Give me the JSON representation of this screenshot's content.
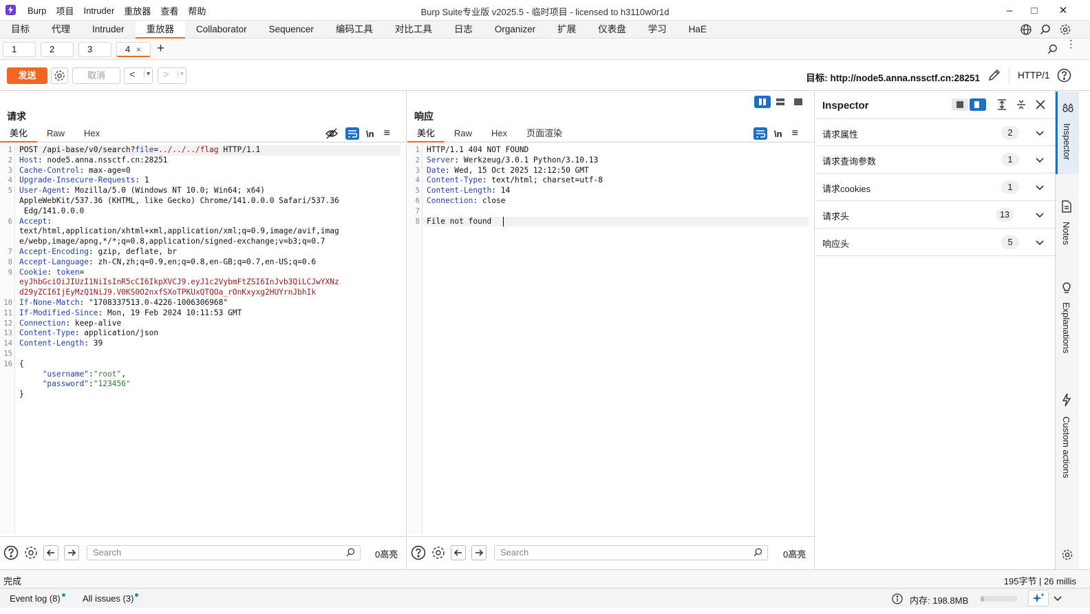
{
  "window": {
    "title": "Burp Suite专业版  v2025.5 - 临时项目 - licensed to h3110w0r1d",
    "menu": [
      "Burp",
      "项目",
      "Intruder",
      "重放器",
      "查看",
      "帮助"
    ],
    "minimize": "–",
    "maximize": "□",
    "close": "✕"
  },
  "nav": {
    "tabs": [
      "目标",
      "代理",
      "Intruder",
      "重放器",
      "Collaborator",
      "Sequencer",
      "编码工具",
      "对比工具",
      "日志",
      "Organizer",
      "扩展",
      "仪表盘",
      "学习",
      "HaE"
    ],
    "active": 3
  },
  "subtabs": {
    "items": [
      "1",
      "2",
      "3",
      "4"
    ],
    "active_close": "×",
    "add": "+"
  },
  "toolbar": {
    "send": "发送",
    "cancel": "取消",
    "back": "<",
    "back_dropdown": "▾",
    "forward": ">",
    "forward_dropdown": "▾",
    "target": "目标: http://node5.anna.nssctf.cn:28251",
    "http_version": "HTTP/1"
  },
  "request": {
    "title": "请求",
    "tabs": [
      "美化",
      "Raw",
      "Hex"
    ],
    "newline_toggle": "\\n",
    "lines": [
      {
        "n": "1",
        "parts": [
          [
            "",
            "POST /api-base/v0/search?"
          ],
          [
            "hn",
            "file"
          ],
          [
            "",
            "="
          ],
          [
            "pv",
            "../../../flag"
          ],
          [
            "",
            " HTTP/1.1"
          ]
        ]
      },
      {
        "n": "2",
        "parts": [
          [
            "hn",
            "Host"
          ],
          [
            "",
            ": node5.anna.nssctf.cn:28251"
          ]
        ]
      },
      {
        "n": "3",
        "parts": [
          [
            "hn",
            "Cache-Control"
          ],
          [
            "",
            ": max-age=0"
          ]
        ]
      },
      {
        "n": "4",
        "parts": [
          [
            "hn",
            "Upgrade-Insecure-Requests"
          ],
          [
            "",
            ": 1"
          ]
        ]
      },
      {
        "n": "5",
        "parts": [
          [
            "hn",
            "User-Agent"
          ],
          [
            "",
            ": Mozilla/5.0 (Windows NT 10.0; Win64; x64)"
          ]
        ]
      },
      {
        "n": "",
        "parts": [
          [
            "",
            "AppleWebKit/537.36 (KHTML, like Gecko) Chrome/141.0.0.0 Safari/537.36"
          ]
        ]
      },
      {
        "n": "",
        "parts": [
          [
            "",
            " Edg/141.0.0.0"
          ]
        ]
      },
      {
        "n": "6",
        "parts": [
          [
            "hn",
            "Accept"
          ],
          [
            "",
            ":"
          ]
        ]
      },
      {
        "n": "",
        "parts": [
          [
            "",
            "text/html,application/xhtml+xml,application/xml;q=0.9,image/avif,imag"
          ]
        ]
      },
      {
        "n": "",
        "parts": [
          [
            "",
            "e/webp,image/apng,*/*;q=0.8,application/signed-exchange;v=b3;q=0.7"
          ]
        ]
      },
      {
        "n": "7",
        "parts": [
          [
            "hn",
            "Accept-Encoding"
          ],
          [
            "",
            ": gzip, deflate, br"
          ]
        ]
      },
      {
        "n": "8",
        "parts": [
          [
            "hn",
            "Accept-Language"
          ],
          [
            "",
            ": zh-CN,zh;q=0.9,en;q=0.8,en-GB;q=0.7,en-US;q=0.6"
          ]
        ]
      },
      {
        "n": "9",
        "parts": [
          [
            "hn",
            "Cookie"
          ],
          [
            "",
            ": "
          ],
          [
            "hn",
            "token"
          ],
          [
            "",
            "="
          ]
        ]
      },
      {
        "n": "",
        "parts": [
          [
            "pv",
            "eyJhbGciOiJIUzI1NiIsInR5cCI6IkpXVCJ9.eyJ1c2VybmFtZSI6InJvb3QiLCJwYXNz"
          ]
        ]
      },
      {
        "n": "",
        "parts": [
          [
            "pv",
            "d29yZCI6IjEyMzQ1NiJ9.V0KS0O2nxfSXoTPKUxQTQOa_rOnKxyxg2HUYrnJbhIk"
          ]
        ]
      },
      {
        "n": "10",
        "parts": [
          [
            "hn",
            "If-None-Match"
          ],
          [
            "",
            ": \"1708337513.0-4226-1006306968\""
          ]
        ]
      },
      {
        "n": "11",
        "parts": [
          [
            "hn",
            "If-Modified-Since"
          ],
          [
            "",
            ": Mon, 19 Feb 2024 10:11:53 GMT"
          ]
        ]
      },
      {
        "n": "12",
        "parts": [
          [
            "hn",
            "Connection"
          ],
          [
            "",
            ": keep-alive"
          ]
        ]
      },
      {
        "n": "13",
        "parts": [
          [
            "hn",
            "Content-Type"
          ],
          [
            "",
            ": application/json"
          ]
        ]
      },
      {
        "n": "14",
        "parts": [
          [
            "hn",
            "Content-Length"
          ],
          [
            "",
            ": 39"
          ]
        ]
      },
      {
        "n": "15",
        "parts": [
          [
            "",
            ""
          ]
        ]
      },
      {
        "n": "16",
        "parts": [
          [
            "",
            "{"
          ]
        ]
      },
      {
        "n": "",
        "parts": [
          [
            "",
            "     "
          ],
          [
            "jk",
            "\"username\""
          ],
          [
            "",
            ":"
          ],
          [
            "jv",
            "\"root\""
          ],
          [
            "",
            ","
          ]
        ]
      },
      {
        "n": "",
        "parts": [
          [
            "",
            "     "
          ],
          [
            "jk",
            "\"password\""
          ],
          [
            "",
            ":"
          ],
          [
            "jv",
            "\"123456\""
          ]
        ]
      },
      {
        "n": "",
        "parts": [
          [
            "",
            "}"
          ]
        ]
      }
    ],
    "search_placeholder": "Search",
    "highlights": "0高亮"
  },
  "response": {
    "title": "响应",
    "tabs": [
      "美化",
      "Raw",
      "Hex",
      "页面渲染"
    ],
    "newline_toggle": "\\n",
    "lines": [
      {
        "n": "1",
        "parts": [
          [
            "",
            "HTTP/1.1 404 NOT FOUND"
          ]
        ]
      },
      {
        "n": "2",
        "parts": [
          [
            "hn",
            "Server"
          ],
          [
            "",
            ": Werkzeug/3.0.1 Python/3.10.13"
          ]
        ]
      },
      {
        "n": "3",
        "parts": [
          [
            "hn",
            "Date"
          ],
          [
            "",
            ": Wed, 15 Oct 2025 12:12:50 GMT"
          ]
        ]
      },
      {
        "n": "4",
        "parts": [
          [
            "hn",
            "Content-Type"
          ],
          [
            "",
            ": text/html; charset=utf-8"
          ]
        ]
      },
      {
        "n": "5",
        "parts": [
          [
            "hn",
            "Content-Length"
          ],
          [
            "",
            ": 14"
          ]
        ]
      },
      {
        "n": "6",
        "parts": [
          [
            "hn",
            "Connection"
          ],
          [
            "",
            ": close"
          ]
        ]
      },
      {
        "n": "7",
        "parts": [
          [
            "",
            ""
          ]
        ]
      },
      {
        "n": "8",
        "parts": [
          [
            "",
            "File not found"
          ]
        ]
      }
    ],
    "search_placeholder": "Search",
    "highlights": "0高亮"
  },
  "inspector": {
    "title": "Inspector",
    "rows": [
      {
        "label": "请求属性",
        "count": "2"
      },
      {
        "label": "请求查询参数",
        "count": "1"
      },
      {
        "label": "请求cookies",
        "count": "1"
      },
      {
        "label": "请求头",
        "count": "13"
      },
      {
        "label": "响应头",
        "count": "5"
      }
    ]
  },
  "siderail": [
    "Inspector",
    "Notes",
    "Explanations",
    "Custom actions"
  ],
  "status": {
    "left": "完成",
    "right": "195字节 | 26 millis",
    "event_log": "Event log (8)",
    "all_issues": "All issues (3)",
    "memory": "内存: 198.8MB"
  },
  "colors": {
    "accent": "#f26522",
    "blue": "#1a6fc9",
    "header_name": "#1f3fb5",
    "param_value": "#a3161b"
  }
}
